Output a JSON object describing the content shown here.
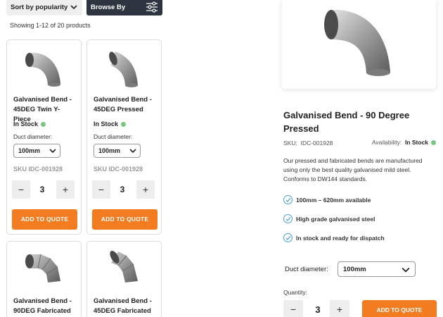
{
  "toolbar": {
    "sort_label": "Sort by popularity",
    "sort_icon": "chevron-down-icon",
    "browse_label": "Browse By",
    "browse_icon": "sliders-icon"
  },
  "results": {
    "showing_text": "Showing 1-12 of 20 products"
  },
  "products": [
    {
      "name": "Galvanised Bend - 45DEG Twin Y-Piece",
      "stock": "In Stock",
      "duct_label": "Duct diameter:",
      "duct_value": "100mm",
      "sku": "SKU IDC-001928",
      "quantity": "3",
      "minus": "−",
      "plus": "+",
      "add_label": "ADD TO QUOTE",
      "image_icon": "elbow-pipe-icon"
    },
    {
      "name": "Galvanised Bend - 45DEG Pressed",
      "stock": "In Stock",
      "duct_label": "Duct diameter:",
      "duct_value": "100mm",
      "sku": "SKU IDC-001928",
      "quantity": "3",
      "minus": "−",
      "plus": "+",
      "add_label": "ADD TO QUOTE",
      "image_icon": "elbow-pipe-icon"
    },
    {
      "name": "Galvanised Bend - 90DEG Fabricated",
      "image_icon": "segmented-elbow-icon"
    },
    {
      "name": "Galvanised Bend - 45DEG Fabricated",
      "image_icon": "segmented-elbow-icon"
    }
  ],
  "detail": {
    "image_icon": "elbow-pipe-icon",
    "title": "Galvanised Bend - 90 Degree Pressed",
    "sku_label": "SKU:",
    "sku_value": "IDC-001928",
    "availability_label": "Availability:",
    "availability_value": "In Stock",
    "description": "Our pressed and fabricated bends are manufactured using only the best quality galvanised mild steel. Conforms to DW144 standards.",
    "features": [
      "100mm – 620mm available",
      "High grade galvanised steel",
      "In stock and ready for dispatch"
    ],
    "duct_label": "Duct diameter:",
    "duct_value": "100mm",
    "quantity_label": "Quantity:",
    "quantity": "3",
    "minus": "−",
    "plus": "+",
    "add_label": "ADD TO QUOTE"
  },
  "colors": {
    "accent": "#f47c20",
    "dark_button": "#2f3540",
    "stock_dot": "#7bc67e",
    "check": "#4a9fd5"
  }
}
